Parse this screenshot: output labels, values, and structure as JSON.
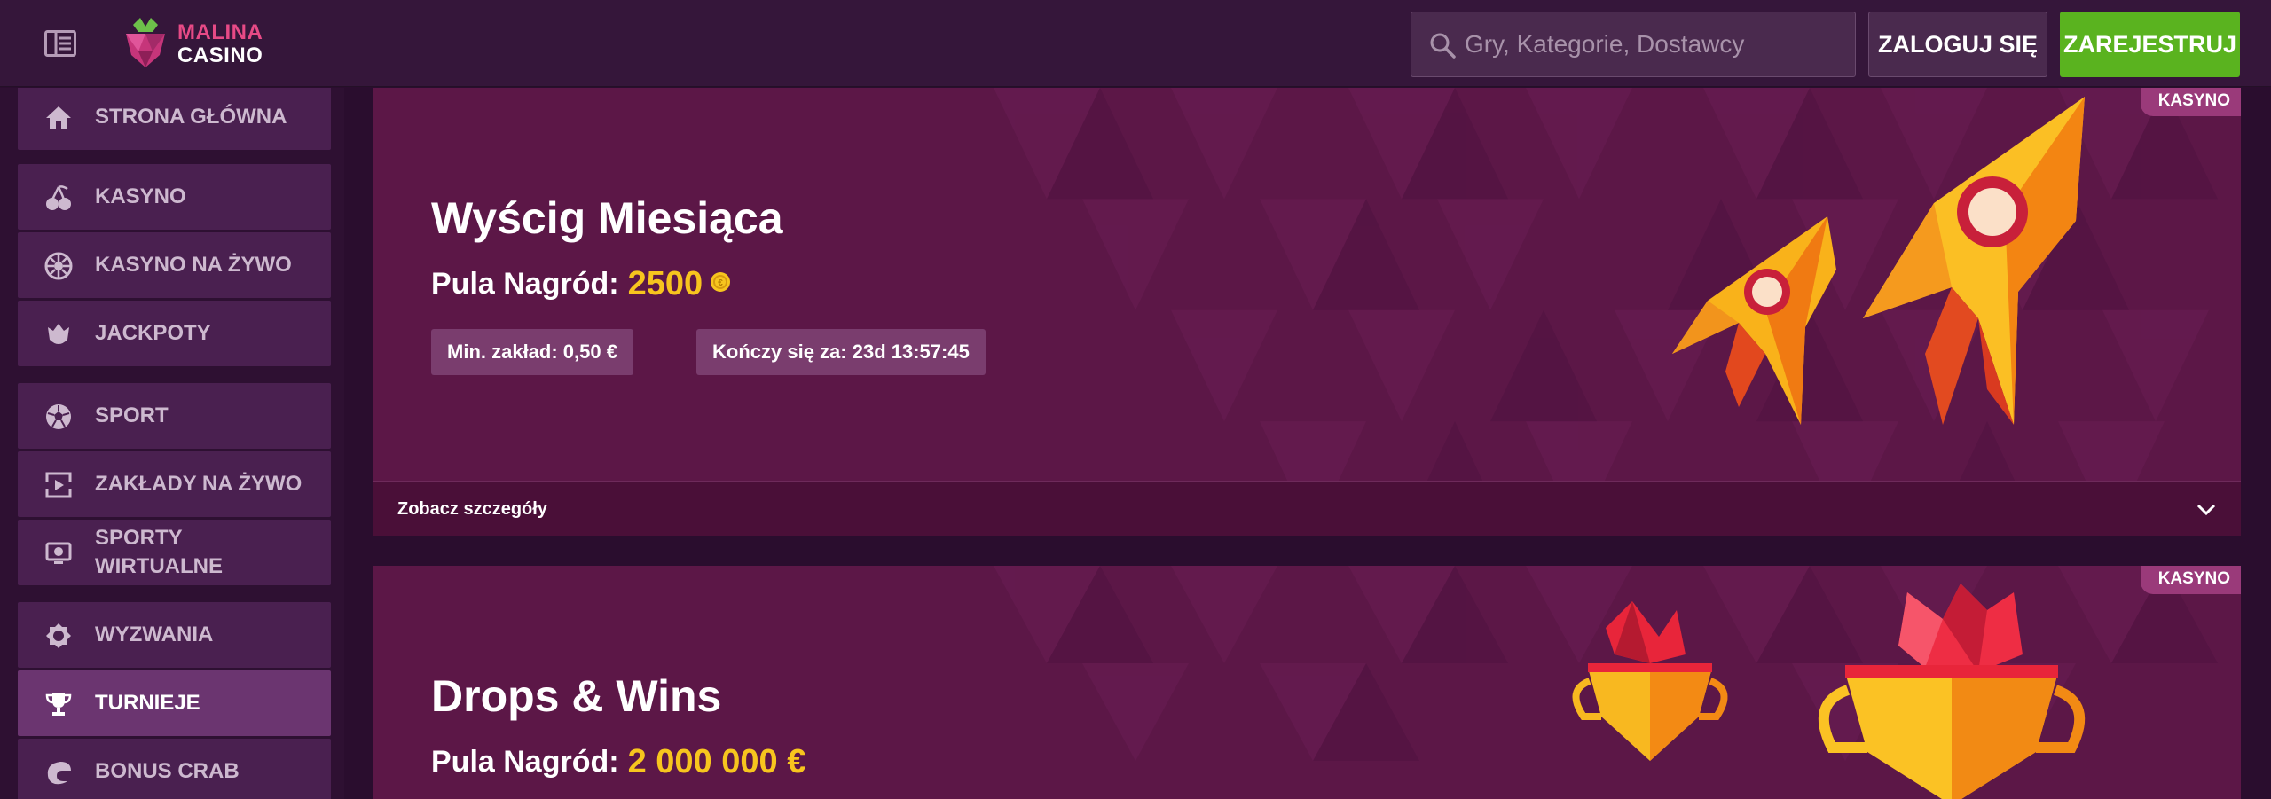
{
  "header": {
    "logo_line1": "MALINA",
    "logo_line2": "CASINO",
    "search_placeholder": "Gry, Kategorie, Dostawcy",
    "login_label": "ZALOGUJ SIĘ",
    "register_label": "ZAREJESTRUJ"
  },
  "sidebar": {
    "items": [
      {
        "label": "STRONA GŁÓWNA",
        "icon": "home-icon"
      },
      {
        "label": "KASYNO",
        "icon": "cherries-icon"
      },
      {
        "label": "KASYNO NA ŻYWO",
        "icon": "roulette-icon"
      },
      {
        "label": "JACKPOTY",
        "icon": "jackpot-icon"
      },
      {
        "label": "SPORT",
        "icon": "football-icon"
      },
      {
        "label": "ZAKŁADY NA ŻYWO",
        "icon": "live-play-icon"
      },
      {
        "label": "SPORTY WIRTUALNE",
        "icon": "virtual-sports-icon"
      },
      {
        "label": "WYZWANIA",
        "icon": "badge-icon"
      },
      {
        "label": "TURNIEJE",
        "icon": "trophy-icon",
        "active": true
      },
      {
        "label": "BONUS CRAB",
        "icon": "crab-claw-icon"
      }
    ]
  },
  "tournaments": [
    {
      "badge": "KASYNO",
      "title": "Wyścig Miesiąca",
      "prize_label": "Pula Nagród:",
      "prize_value": "2500",
      "min_bet": "Min. zakład: 0,50 €",
      "ends_in": "Kończy się za: 23d 13:57:45",
      "details_label": "Zobacz szczegóły"
    },
    {
      "badge": "KASYNO",
      "title": "Drops & Wins",
      "prize_label": "Pula Nagród:",
      "prize_value": "2 000 000 €"
    }
  ],
  "colors": {
    "accent_green": "#5ab31f",
    "prize_gold": "#f7c51e",
    "card_bg": "#5c1747",
    "brand_pink": "#e74a86"
  }
}
